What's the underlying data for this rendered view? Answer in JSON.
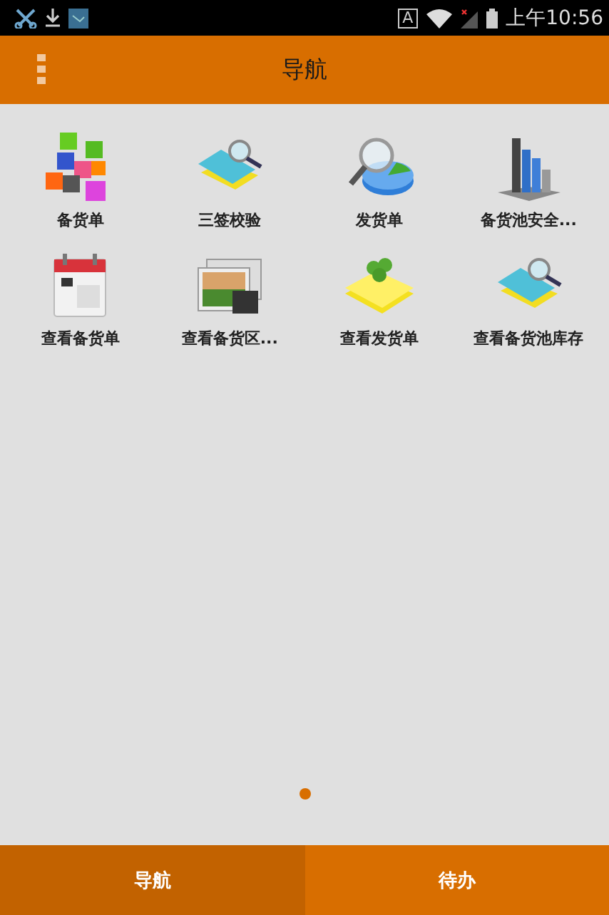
{
  "status_bar": {
    "input_indicator": "A",
    "time": "上午10:56"
  },
  "header": {
    "title": "导航"
  },
  "grid": [
    {
      "label": "备货单"
    },
    {
      "label": "三签校验"
    },
    {
      "label": "发货单"
    },
    {
      "label": "备货池安全..."
    },
    {
      "label": "查看备货单"
    },
    {
      "label": "查看备货区..."
    },
    {
      "label": "查看发货单"
    },
    {
      "label": "查看备货池库存"
    }
  ],
  "pager": [
    {
      "selected": true
    }
  ],
  "bottom_tabs": [
    {
      "label": "导航",
      "selected": true
    },
    {
      "label": "待办",
      "selected": false
    }
  ]
}
